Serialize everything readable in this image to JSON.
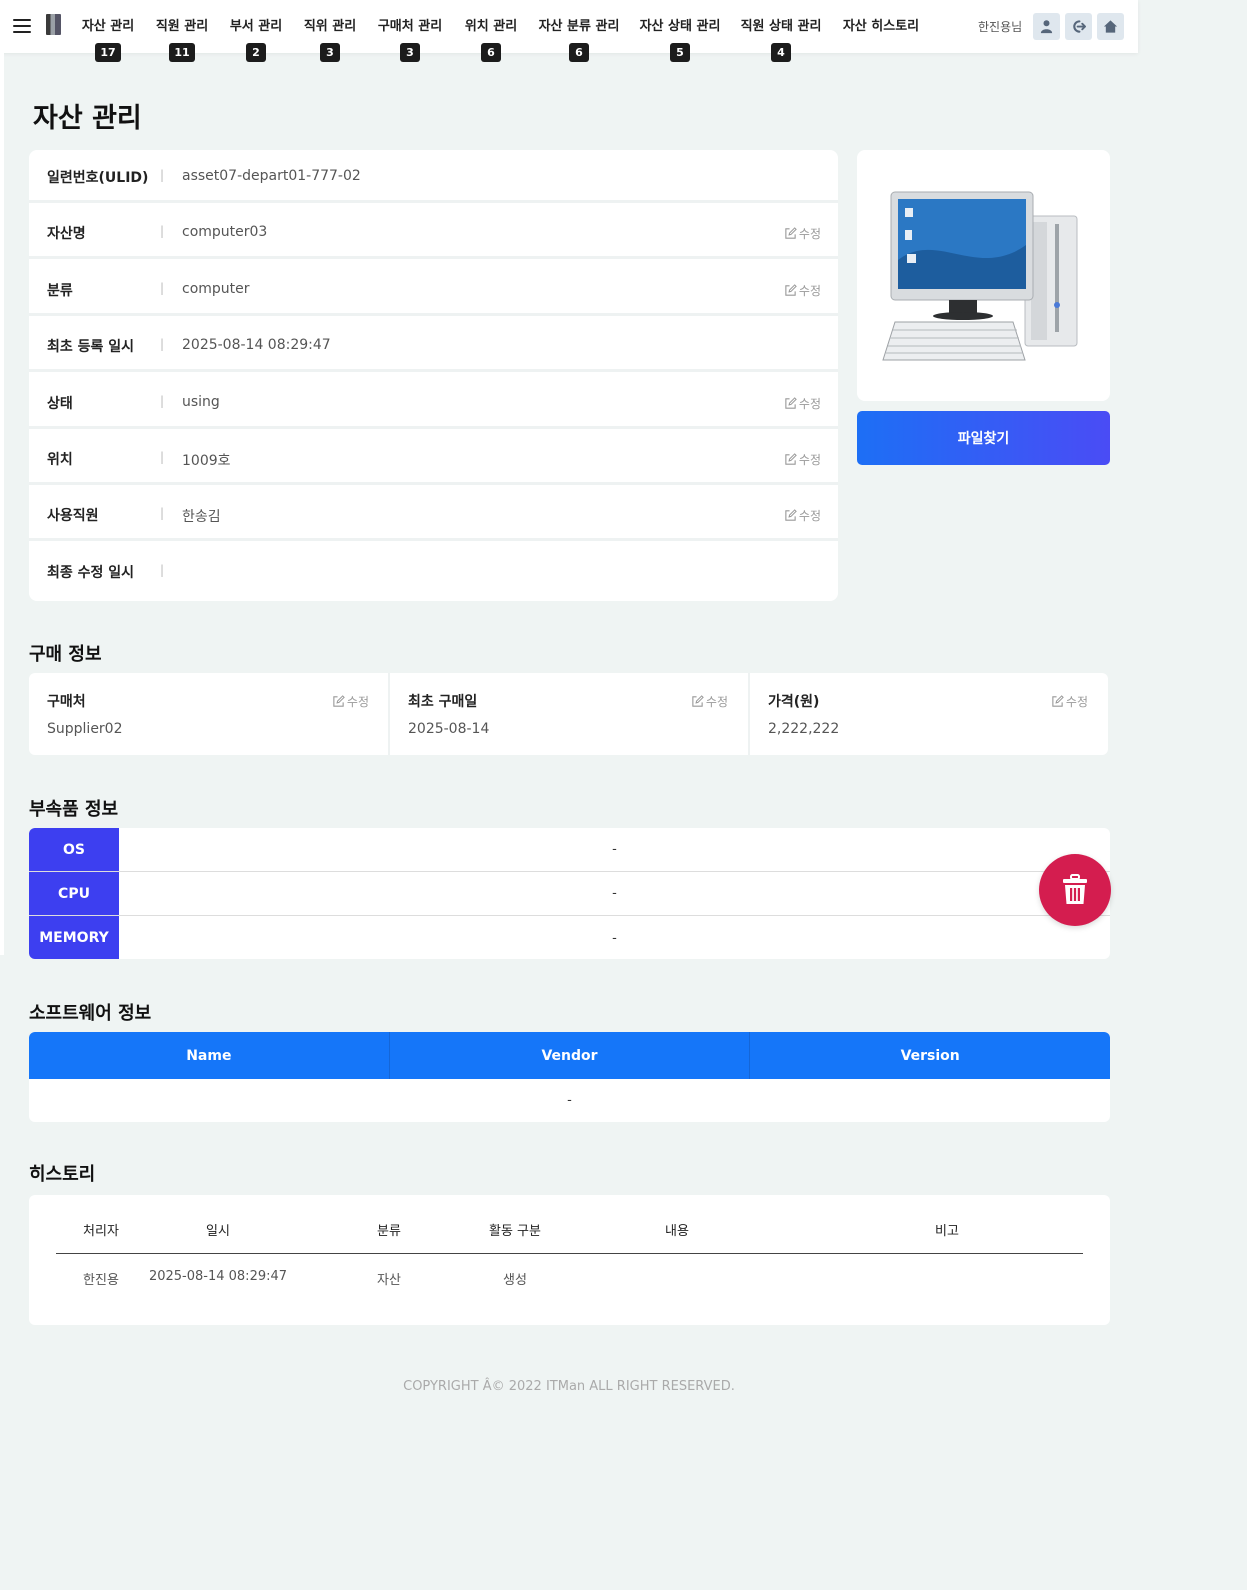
{
  "nav": {
    "items": [
      {
        "label": "자산 관리",
        "badge": "17"
      },
      {
        "label": "직원 관리",
        "badge": "11"
      },
      {
        "label": "부서 관리",
        "badge": "2"
      },
      {
        "label": "직위 관리",
        "badge": "3"
      },
      {
        "label": "구매처 관리",
        "badge": "3"
      },
      {
        "label": "위치 관리",
        "badge": "6"
      },
      {
        "label": "자산 분류 관리",
        "badge": "6"
      },
      {
        "label": "자산 상태 관리",
        "badge": "5"
      },
      {
        "label": "직원 상태 관리",
        "badge": "4"
      },
      {
        "label": "자산 히스토리",
        "badge": ""
      }
    ],
    "user": "한진용님",
    "icons": [
      "user-icon",
      "logout-icon",
      "home-icon"
    ]
  },
  "page": {
    "title": "자산 관리"
  },
  "details": {
    "rows": [
      {
        "label": "일련번호(ULID)",
        "value": "asset07-depart01-777-02",
        "editable": false
      },
      {
        "label": "자산명",
        "value": "computer03",
        "editable": true
      },
      {
        "label": "분류",
        "value": "computer",
        "editable": true
      },
      {
        "label": "최초 등록 일시",
        "value": "2025-08-14 08:29:47",
        "editable": false
      },
      {
        "label": "상태",
        "value": "using",
        "editable": true
      },
      {
        "label": "위치",
        "value": "1009호",
        "editable": true
      },
      {
        "label": "사용직원",
        "value": "한송김",
        "editable": true
      },
      {
        "label": "최종 수정 일시",
        "value": "",
        "editable": false
      }
    ],
    "separator": "|",
    "edit_label": "수정"
  },
  "file_button": {
    "label": "파일찾기"
  },
  "purchase": {
    "title": "구매 정보",
    "columns": [
      {
        "label": "구매처",
        "value": "Supplier02"
      },
      {
        "label": "최초 구매일",
        "value": "2025-08-14"
      },
      {
        "label": "가격(원)",
        "value": "2,222,222"
      }
    ],
    "edit_label": "수정"
  },
  "parts": {
    "title": "부속품 정보",
    "rows": [
      {
        "label": "OS",
        "value": "-"
      },
      {
        "label": "CPU",
        "value": "-"
      },
      {
        "label": "MEMORY",
        "value": "-"
      }
    ]
  },
  "software": {
    "title": "소프트웨어 정보",
    "headers": [
      "Name",
      "Vendor",
      "Version"
    ],
    "empty": "-"
  },
  "history": {
    "title": "히스토리",
    "headers": [
      "처리자",
      "일시",
      "분류",
      "활동 구분",
      "내용",
      "비고"
    ],
    "rows": [
      [
        "한진용",
        "2025-08-14 08:29:47",
        "자산",
        "생성",
        "",
        ""
      ]
    ]
  },
  "footer": {
    "text": "COPYRIGHT Â© 2022 ITMan ALL RIGHT RESERVED."
  },
  "colors": {
    "accent_blue": "#1576f9",
    "parts_label": "#3d3ff0",
    "delete": "#d41d4f",
    "background": "#eff4f3"
  }
}
